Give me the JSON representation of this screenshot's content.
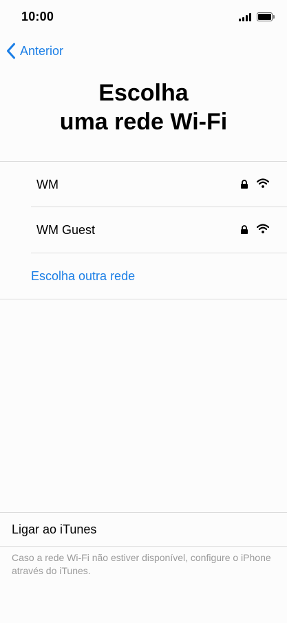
{
  "status_bar": {
    "time": "10:00",
    "battery_level": 1.0
  },
  "nav": {
    "back_label": "Anterior",
    "accent_color": "#1a7ee6"
  },
  "title": {
    "line1": "Escolha",
    "line2": "uma rede Wi-Fi"
  },
  "networks": [
    {
      "name": "WM",
      "secured": true,
      "signal_icon": "wifi-full-icon"
    },
    {
      "name": "WM Guest",
      "secured": true,
      "signal_icon": "wifi-full-icon"
    }
  ],
  "other_network_label": "Escolha outra rede",
  "itunes": {
    "label": "Ligar ao iTunes",
    "note": "Caso a rede Wi-Fi não estiver disponível, configure o iPhone através do iTunes."
  }
}
